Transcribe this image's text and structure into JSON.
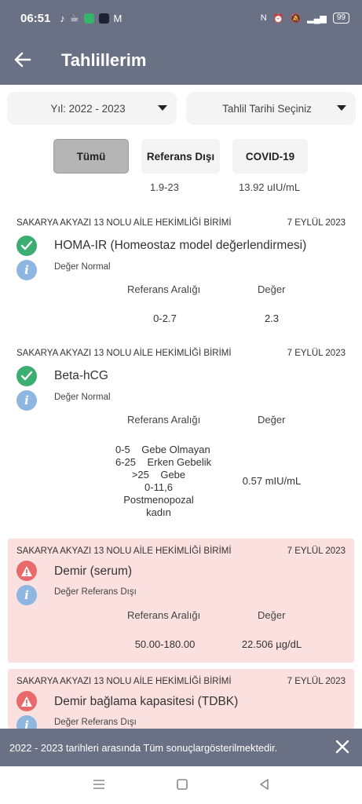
{
  "status_bar": {
    "time": "06:51",
    "battery": "99",
    "right_icons": [
      "nfc-icon",
      "alarm-icon",
      "mute-icon",
      "volte-icon",
      "signal-icon"
    ]
  },
  "app_bar": {
    "title": "Tahlillerim"
  },
  "filters": {
    "year": "Yıl: 2022 - 2023",
    "date": "Tahlil Tarihi Seçiniz"
  },
  "tabs": [
    {
      "label": "Tümü",
      "active": true
    },
    {
      "label": "Referans Dışı",
      "active": false
    },
    {
      "label": "COVID-19",
      "active": false
    }
  ],
  "previous_row": {
    "ref": "1.9-23",
    "value": "13.92 uIU/mL"
  },
  "results": [
    {
      "institution": "SAKARYA AKYAZI 13 NOLU AİLE HEKİMLİĞİ BİRİMİ",
      "date": "7 EYLÜL 2023",
      "name": "HOMA-IR (Homeostaz model değerlendirmesi)",
      "status": "Değer Normal",
      "ref_header": "Referans Aralığı",
      "value_header": "Değer",
      "ref": "0-2.7",
      "value": "2.3"
    },
    {
      "institution": "SAKARYA AKYAZI 13 NOLU AİLE HEKİMLİĞİ BİRİMİ",
      "date": "7 EYLÜL 2023",
      "name": "Beta-hCG",
      "status": "Değer Normal",
      "ref_header": "Referans Aralığı",
      "value_header": "Değer",
      "ref_lines": [
        "0-5    Gebe Olmayan",
        "6-25    Erken Gebelik",
        ">25    Gebe",
        "0-11,6",
        "Postmenopozal",
        "kadın"
      ],
      "value": "0.57 mIU/mL"
    },
    {
      "institution": "SAKARYA AKYAZI 13 NOLU AİLE HEKİMLİĞİ BİRİMİ",
      "date": "7 EYLÜL 2023",
      "name": "Demir (serum)",
      "status": "Değer Referans Dışı",
      "ref_header": "Referans Aralığı",
      "value_header": "Değer",
      "ref": "50.00-180.00",
      "value": "22.506 µg/dL"
    },
    {
      "institution": "SAKARYA AKYAZI 13 NOLU AİLE HEKİMLİĞİ BİRİMİ",
      "date": "7 EYLÜL 2023",
      "name": "Demir bağlama kapasitesi (TDBK)",
      "status": "Değer Referans Dışı"
    }
  ],
  "snackbar": {
    "message": "2022 - 2023 tarihleri arasında Tüm sonuçlargösterilmektedir."
  },
  "colors": {
    "header": "#6b7185",
    "ok": "#3cae72",
    "warn": "#e96a6a",
    "info": "#8db6e0",
    "alert_bg": "#fbe0e0"
  }
}
